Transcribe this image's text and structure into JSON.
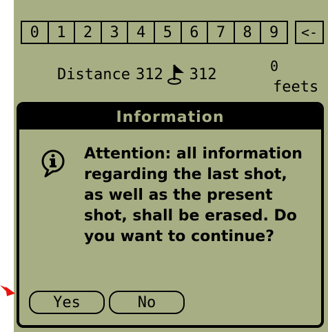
{
  "keypad": {
    "keys": [
      "0",
      "1",
      "2",
      "3",
      "4",
      "5",
      "6",
      "7",
      "8",
      "9"
    ],
    "backspace": "<-"
  },
  "distance": {
    "label": "Distance",
    "value_left": "312",
    "value_right": "312",
    "zero": "0",
    "unit": "feets"
  },
  "dialog": {
    "title": "Information",
    "message": "Attention: all information regarding the last shot, as well as the present shot, shall be erased.  Do you want to continue?",
    "yes_label": "Yes",
    "no_label": "No"
  },
  "colors": {
    "screen": "#a8ae84",
    "ink": "#000000",
    "arrow": "#e8140c"
  },
  "icons": [
    "flag-icon",
    "info-icon",
    "arrow-icon"
  ]
}
